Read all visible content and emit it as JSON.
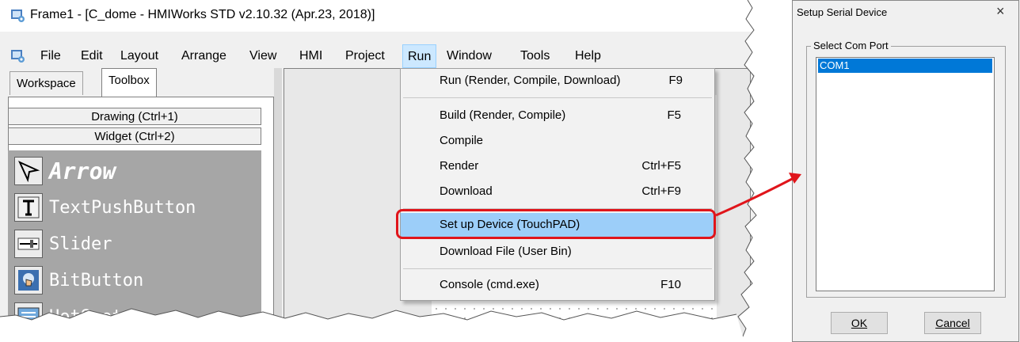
{
  "window": {
    "title": "Frame1 - [C_dome - HMIWorks STD v2.10.32 (Apr.23, 2018)]"
  },
  "menubar": {
    "items": [
      "File",
      "Edit",
      "Layout",
      "Arrange",
      "View",
      "HMI",
      "Project",
      "Run",
      "Window",
      "Tools",
      "Help"
    ],
    "active": "Run"
  },
  "tabs": {
    "workspace": "Workspace",
    "toolbox": "Toolbox"
  },
  "toolbox": {
    "drawing_header": "Drawing (Ctrl+1)",
    "widget_header": "Widget (Ctrl+2)",
    "items": [
      {
        "label": "Arrow",
        "icon": "arrow-icon"
      },
      {
        "label": "TextPushButton",
        "icon": "text-button-icon"
      },
      {
        "label": "Slider",
        "icon": "slider-icon"
      },
      {
        "label": "BitButton",
        "icon": "bitbutton-icon"
      },
      {
        "label": "HotSpot",
        "icon": "hotspot-icon"
      }
    ]
  },
  "run_menu": {
    "items": [
      {
        "label": "Run (Render, Compile, Download)",
        "shortcut": "F9"
      },
      {
        "label": "Build (Render, Compile)",
        "shortcut": "F5"
      },
      {
        "label": "Compile",
        "shortcut": ""
      },
      {
        "label": "Render",
        "shortcut": "Ctrl+F5"
      },
      {
        "label": "Download",
        "shortcut": "Ctrl+F9"
      },
      {
        "label": "Set up Device (TouchPAD)",
        "shortcut": ""
      },
      {
        "label": "Download File (User Bin)",
        "shortcut": ""
      },
      {
        "label": "Console (cmd.exe)",
        "shortcut": "F10"
      }
    ],
    "highlighted": "Set up Device (TouchPAD)"
  },
  "dialog": {
    "title": "Setup Serial Device",
    "close_glyph": "×",
    "group_label": "Select Com Port",
    "ports": [
      "COM1"
    ],
    "selected_port": "COM1",
    "ok_label": "OK",
    "cancel_label": "Cancel"
  },
  "colors": {
    "highlight_box": "#e0151b",
    "arrow": "#e0151b",
    "menu_highlight": "#9ccef9",
    "list_selection": "#0078d7"
  }
}
